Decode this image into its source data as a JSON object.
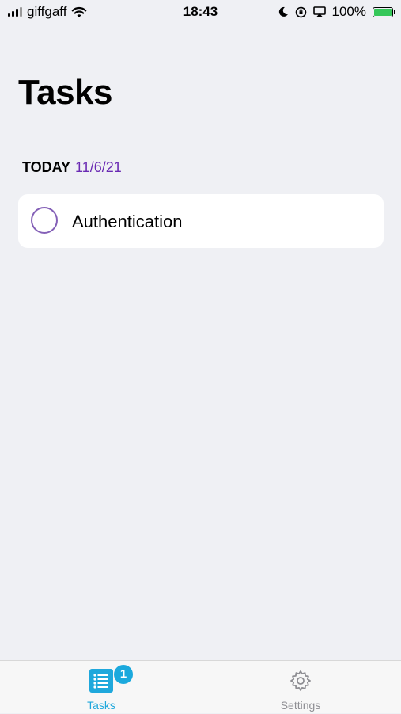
{
  "status_bar": {
    "carrier": "giffgaff",
    "time": "18:43",
    "battery": "100%"
  },
  "header": {
    "title": "Tasks"
  },
  "section": {
    "label": "TODAY",
    "date": "11/6/21"
  },
  "tasks": [
    {
      "title": "Authentication",
      "completed": false
    }
  ],
  "tab_bar": {
    "tabs": [
      {
        "label": "Tasks",
        "badge": "1",
        "icon": "list-icon",
        "active": true
      },
      {
        "label": "Settings",
        "icon": "gear-icon",
        "active": false
      }
    ]
  },
  "colors": {
    "accent": "#1fa8dc",
    "date": "#6a2ab3",
    "task_circle": "#8460b7",
    "background": "#eff0f4"
  }
}
